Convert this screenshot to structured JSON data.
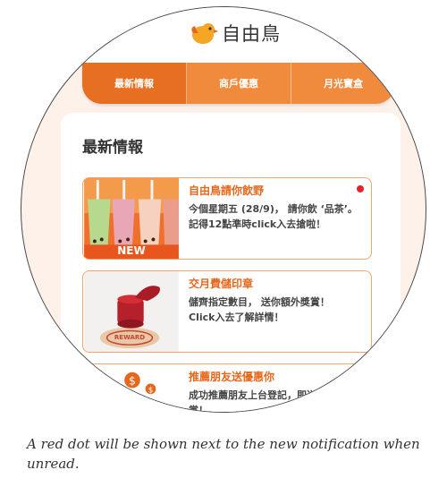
{
  "app": {
    "logo_text": "自由鳥"
  },
  "tabs": [
    {
      "label": "最新情報",
      "active": true
    },
    {
      "label": "商戶優惠",
      "active": false
    },
    {
      "label": "月光寶盒",
      "active": false
    }
  ],
  "section": {
    "title": "最新情報"
  },
  "notifications": [
    {
      "title": "自由鳥請你飲野",
      "body": "今個星期五 (28/9)， 請你飲 ‘品茶’。記得12點準時click入去搶啦！",
      "badge": "NEW",
      "unread": true,
      "thumb_icon": "bubble-tea-icon"
    },
    {
      "title": "交月費儲印章",
      "body": "儲齊指定數目， 送你額外獎賞！",
      "body2": "Click入去了解詳情！",
      "unread": false,
      "thumb_icon": "stamp-icon",
      "stamp_text": "REWARD"
    },
    {
      "title": "推薦朋友送優惠你",
      "body": "成功推薦朋友上台登記，即送你額外獎賞！",
      "unread": false,
      "thumb_icon": "coins-icon"
    }
  ],
  "caption": "A red dot will be shown next to the new notification when unread.",
  "colors": {
    "accent": "#f08a3c",
    "accent_dark": "#e5671c",
    "unread_dot": "#e5242c"
  }
}
